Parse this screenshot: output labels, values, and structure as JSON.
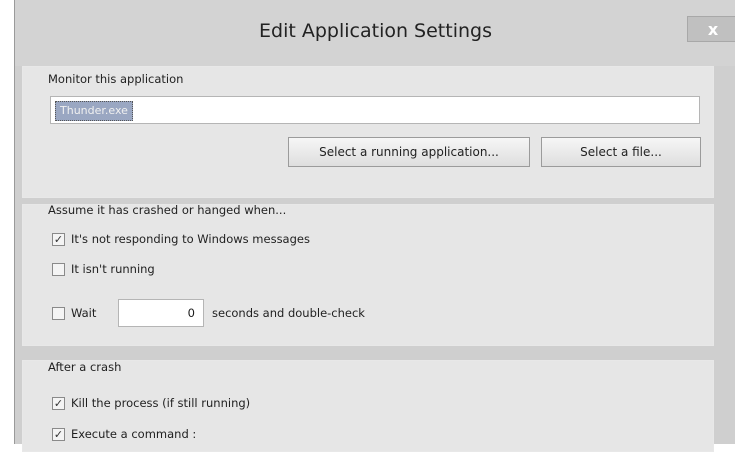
{
  "dialog": {
    "title": "Edit Application Settings",
    "close_glyph": "x"
  },
  "monitor": {
    "group_label": "Monitor this application",
    "app_value": "Thunder.exe",
    "select_running_label": "Select a running application...",
    "select_file_label": "Select a file..."
  },
  "crash_conditions": {
    "group_label": "Assume it has crashed or hanged when...",
    "not_responding": {
      "label": "It's not responding to Windows messages",
      "checked": true
    },
    "not_running": {
      "label": "It isn't running",
      "checked": false
    },
    "wait": {
      "label": "Wait",
      "checked": false,
      "seconds_value": "0",
      "suffix": "seconds and double-check"
    }
  },
  "after_crash": {
    "group_label": "After a crash",
    "kill_process": {
      "label": "Kill the process (if still running)",
      "checked": true
    },
    "execute_command": {
      "label": "Execute a command :",
      "checked": true
    }
  }
}
